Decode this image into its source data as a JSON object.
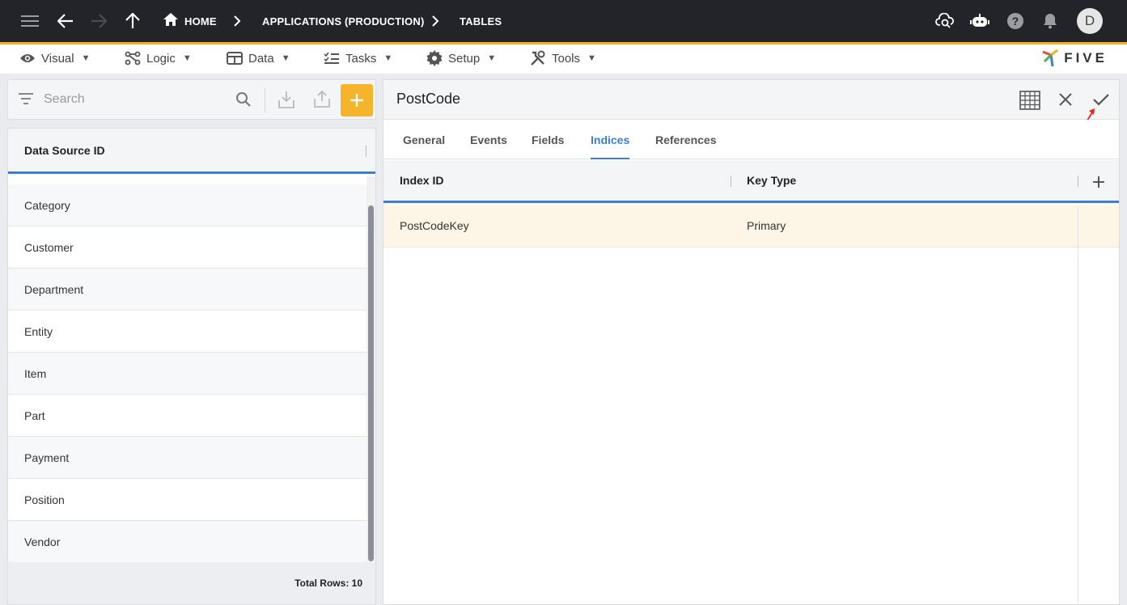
{
  "topbar": {
    "breadcrumbs": [
      "HOME",
      "APPLICATIONS (PRODUCTION)",
      "TABLES"
    ],
    "avatar_letter": "D"
  },
  "menu": {
    "items": [
      {
        "label": "Visual",
        "icon": "eye-icon"
      },
      {
        "label": "Logic",
        "icon": "logic-icon"
      },
      {
        "label": "Data",
        "icon": "table-icon"
      },
      {
        "label": "Tasks",
        "icon": "tasks-icon"
      },
      {
        "label": "Setup",
        "icon": "gear-icon"
      },
      {
        "label": "Tools",
        "icon": "tools-icon"
      }
    ],
    "caret": "▼",
    "logo_text": "FIVE"
  },
  "search": {
    "placeholder": "Search"
  },
  "list": {
    "header": "Data Source ID",
    "rows": [
      "Category",
      "Customer",
      "Department",
      "Entity",
      "Item",
      "Part",
      "Payment",
      "Position",
      "Vendor"
    ],
    "footer": "Total Rows: 10"
  },
  "detail": {
    "title": "PostCode",
    "tabs": [
      "General",
      "Events",
      "Fields",
      "Indices",
      "References"
    ],
    "active_tab": "Indices",
    "columns": [
      "Index ID",
      "Key Type"
    ],
    "rows": [
      {
        "index_id": "PostCodeKey",
        "key_type": "Primary"
      }
    ]
  },
  "colors": {
    "accent": "#3b7dd8",
    "brand": "#f6b42a",
    "topbar": "#222429",
    "selected_row": "#fdf6e6"
  }
}
